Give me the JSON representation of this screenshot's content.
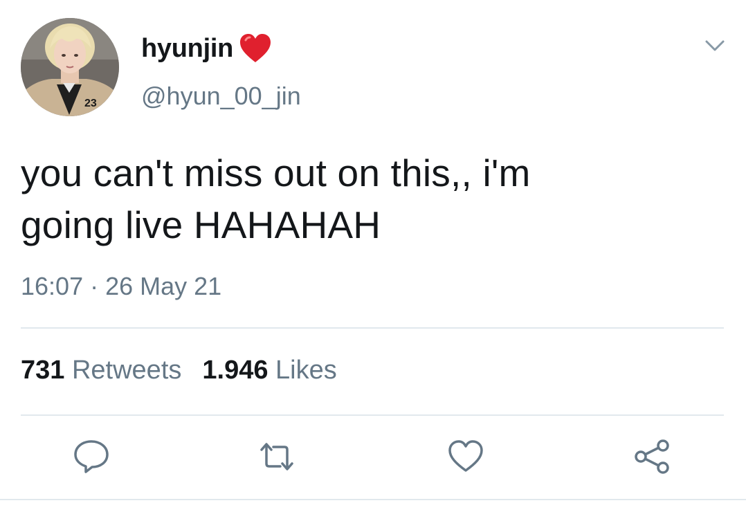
{
  "author": {
    "display_name": "hyunjin",
    "name_emoji": "red-heart-emoji",
    "handle": "@hyun_00_jin"
  },
  "tweet": {
    "text_line1": "you can't miss out on this,, i'm",
    "text_line2": "going live HAHAHAH",
    "timestamp": "16:07 · 26 May 21"
  },
  "stats": {
    "retweets_count": "731",
    "retweets_label": "Retweets",
    "likes_count": "1.946",
    "likes_label": "Likes"
  },
  "icons": {
    "caret": "chevron-down-icon",
    "reply": "reply-icon",
    "retweet": "retweet-icon",
    "like": "heart-icon",
    "share": "share-icon"
  },
  "colors": {
    "text_primary": "#14171a",
    "text_secondary": "#657786",
    "divider": "#e1e8ed",
    "heart_emoji": "#e0202e"
  }
}
